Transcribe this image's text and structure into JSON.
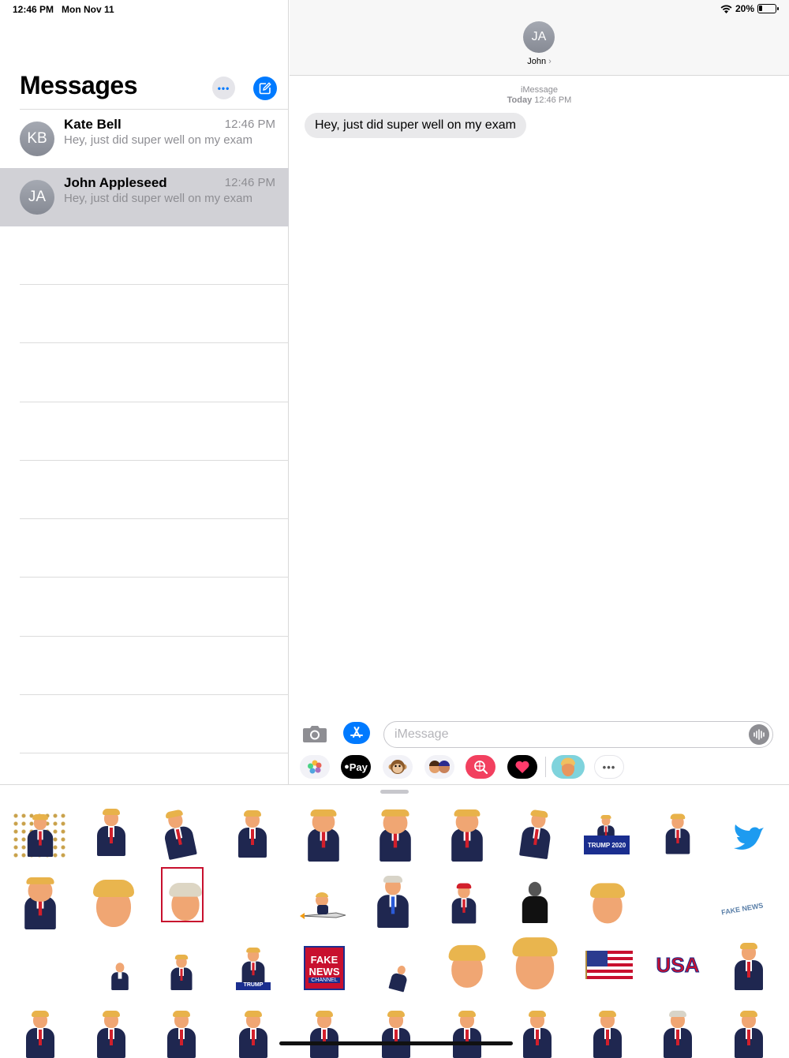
{
  "status": {
    "time": "12:46 PM",
    "date": "Mon Nov 11",
    "battery": "20%",
    "battery_level": 0.2
  },
  "sidebar": {
    "title": "Messages",
    "more_label": "•••",
    "conversations": [
      {
        "initials": "KB",
        "name": "Kate Bell",
        "time": "12:46 PM",
        "preview": "Hey, just did super well on my exam",
        "selected": false
      },
      {
        "initials": "JA",
        "name": "John Appleseed",
        "time": "12:46 PM",
        "preview": "Hey, just did super well on my exam",
        "selected": true
      }
    ]
  },
  "conversation": {
    "contact_initials": "JA",
    "contact_name": "John",
    "service": "iMessage",
    "timestamp_day": "Today",
    "timestamp_time": "12:46 PM",
    "messages": [
      {
        "text": "Hey, just did super well on my exam",
        "from": "received"
      }
    ],
    "input_placeholder": "iMessage"
  },
  "app_strip": {
    "items": [
      "photos-icon",
      "apple-pay",
      "animoji-icon",
      "memoji-icon",
      "search-images-icon",
      "digital-touch-icon",
      "trump-stickers-icon",
      "more-apps-icon"
    ],
    "apple_pay_label": "Pay",
    "more_label": "•••"
  },
  "stickers": {
    "trump_2020_sign": "TRUMP 2020",
    "fake_news_line1": "FAKE",
    "fake_news_line2": "NEWS",
    "fake_news_line3": "CHANNEL",
    "usa_text": "USA",
    "trump_label": "TRUMP",
    "fake_news_small": "FAKE NEWS"
  },
  "colors": {
    "accent": "#007aff",
    "selected_row": "#d1d1d6",
    "bubble": "#e9e9eb"
  }
}
